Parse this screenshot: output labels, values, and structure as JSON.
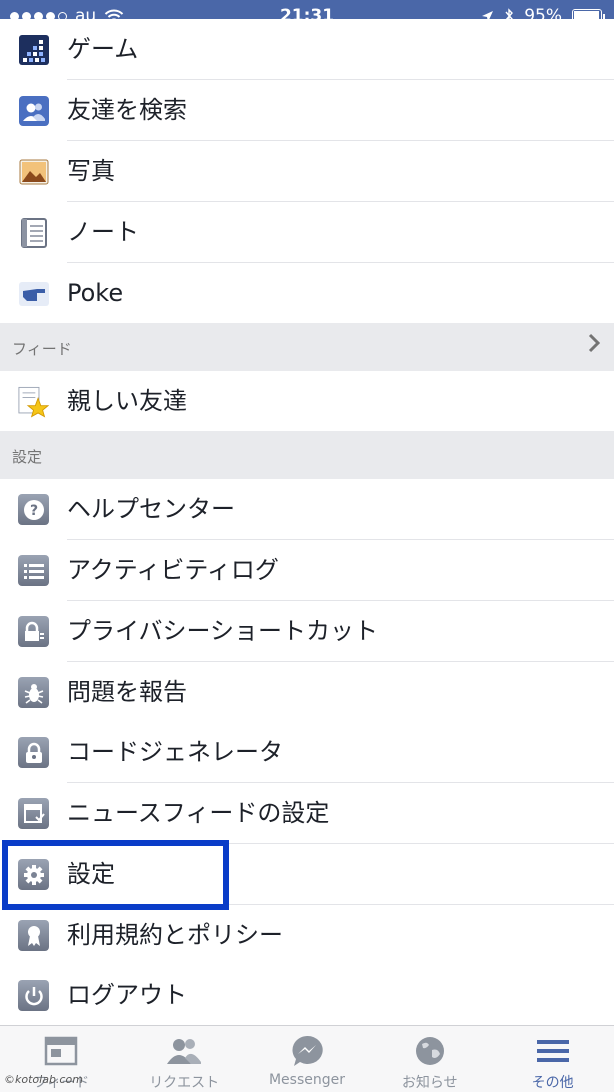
{
  "status_bar": {
    "carrier": "au",
    "time": "21:31",
    "battery": "95%",
    "battery_level": 0.95
  },
  "menu": {
    "apps": [
      {
        "label": "ゲーム",
        "icon": "games-icon"
      },
      {
        "label": "友達を検索",
        "icon": "find-friends-icon"
      },
      {
        "label": "写真",
        "icon": "photos-icon"
      },
      {
        "label": "ノート",
        "icon": "notes-icon"
      },
      {
        "label": "Poke",
        "icon": "poke-icon"
      }
    ],
    "feed_header": "フィード",
    "feed_items": [
      {
        "label": "親しい友達",
        "icon": "close-friends-star-icon"
      }
    ],
    "settings_header": "設定",
    "settings_items": [
      {
        "label": "ヘルプセンター",
        "icon": "help-icon"
      },
      {
        "label": "アクティビティログ",
        "icon": "activity-log-icon"
      },
      {
        "label": "プライバシーショートカット",
        "icon": "privacy-lock-icon"
      },
      {
        "label": "問題を報告",
        "icon": "bug-icon"
      },
      {
        "label": "コードジェネレータ",
        "icon": "code-generator-lock-icon"
      },
      {
        "label": "ニュースフィードの設定",
        "icon": "news-feed-prefs-icon"
      },
      {
        "label": "設定",
        "icon": "gear-icon"
      },
      {
        "label": "利用規約とポリシー",
        "icon": "terms-ribbon-icon"
      },
      {
        "label": "ログアウト",
        "icon": "power-icon"
      }
    ]
  },
  "tab_bar": {
    "tabs": [
      {
        "label": "フィード",
        "icon": "news-feed-icon"
      },
      {
        "label": "リクエスト",
        "icon": "friend-requests-icon"
      },
      {
        "label": "Messenger",
        "icon": "messenger-icon"
      },
      {
        "label": "お知らせ",
        "icon": "globe-notifications-icon"
      },
      {
        "label": "その他",
        "icon": "menu-hamburger-icon"
      }
    ]
  },
  "watermark": "©kotolab.com",
  "colors": {
    "header_blue": "#4a67a8",
    "highlight_blue": "#0a3cc8",
    "section_gray": "#e9eaed"
  }
}
